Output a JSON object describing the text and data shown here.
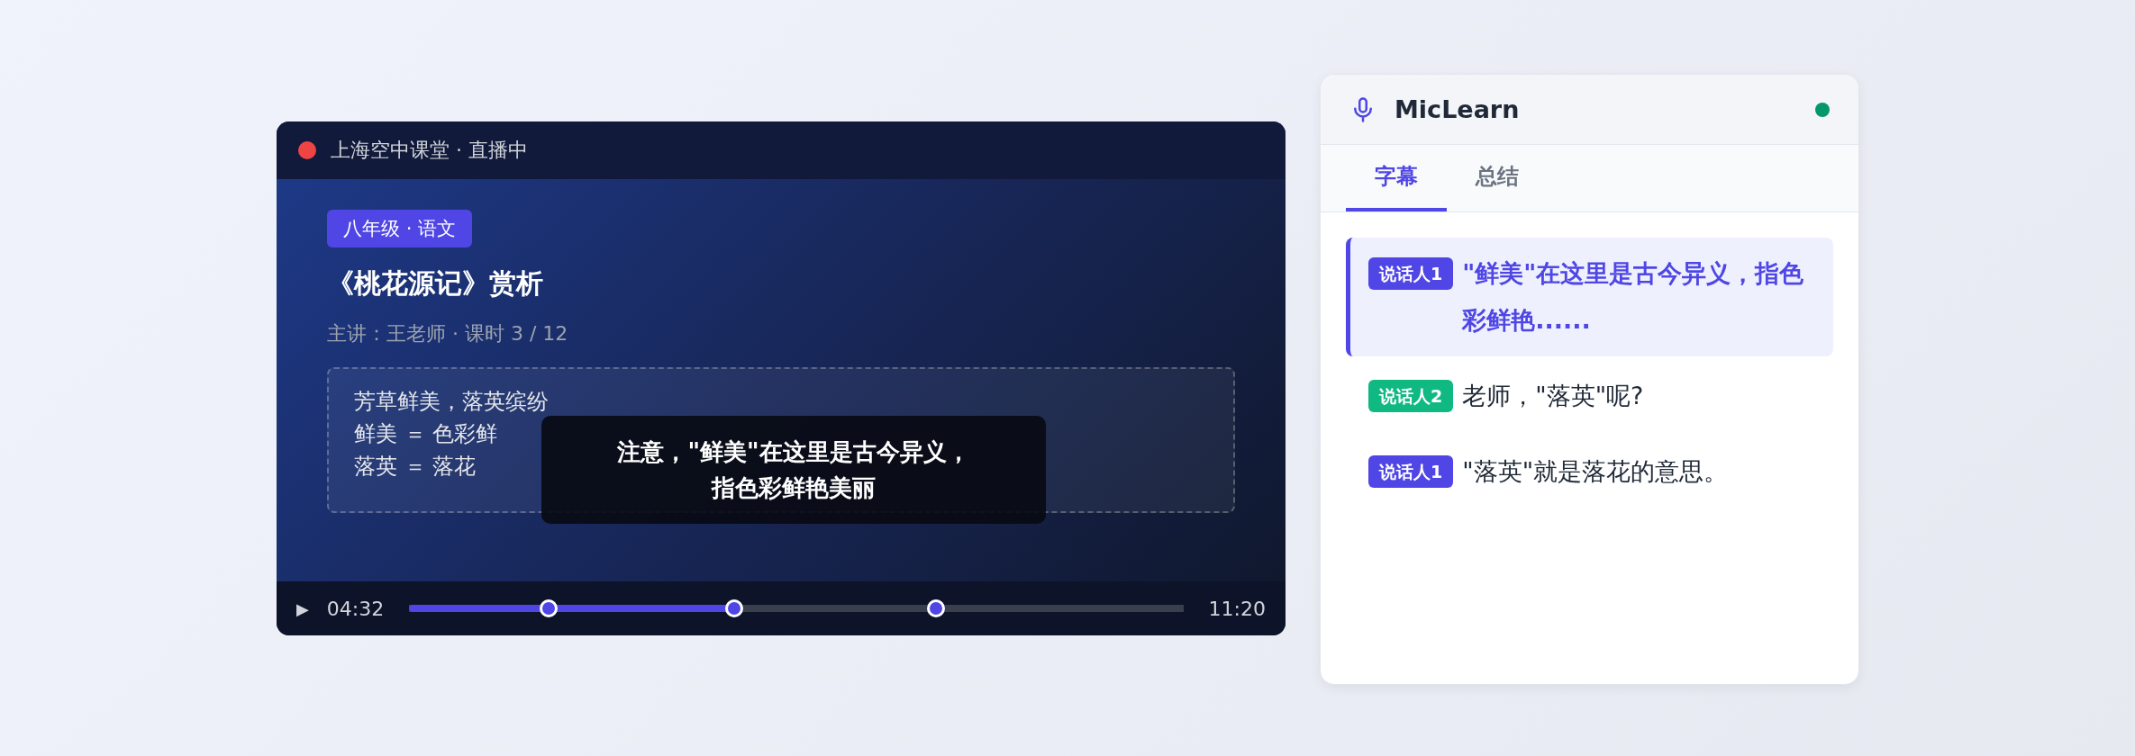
{
  "player": {
    "title": "上海空中课堂 · 直播中",
    "live": true,
    "tag": "八年级 · 语文",
    "lesson_title": "《桃花源记》赏析",
    "lesson_info": "主讲：王老师 · 课时 3 / 12",
    "board_lines": [
      "芳草鲜美，落英缤纷",
      "鲜美 ＝ 色彩鲜",
      "落英 ＝ 落花"
    ],
    "caption_lines": [
      "注意，\"鲜美\"在这里是古今异义，",
      "指色彩鲜艳美丽"
    ],
    "play_icon": "▶",
    "current_time": "04:32",
    "total_time": "11:20",
    "level": 0.42,
    "markers": [
      {
        "level": 0.18
      },
      {
        "level": 0.42
      },
      {
        "level": 0.68
      }
    ]
  },
  "panel": {
    "app_name": "MicLearn",
    "connected": true,
    "tabs": [
      {
        "label": "字幕",
        "selected": true
      },
      {
        "label": "总结",
        "selected": false
      }
    ],
    "captions": [
      {
        "speaker": "说话人1",
        "color": "#4f46e5",
        "text": "\"鲜美\"在这里是古今异义，指色彩鲜艳......",
        "selected": true
      },
      {
        "speaker": "说话人2",
        "color": "#10b981",
        "text": "老师，\"落英\"呢?",
        "selected": false
      },
      {
        "speaker": "说话人1",
        "color": "#4f46e5",
        "text": "\"落英\"就是落花的意思。",
        "selected": false
      }
    ]
  }
}
